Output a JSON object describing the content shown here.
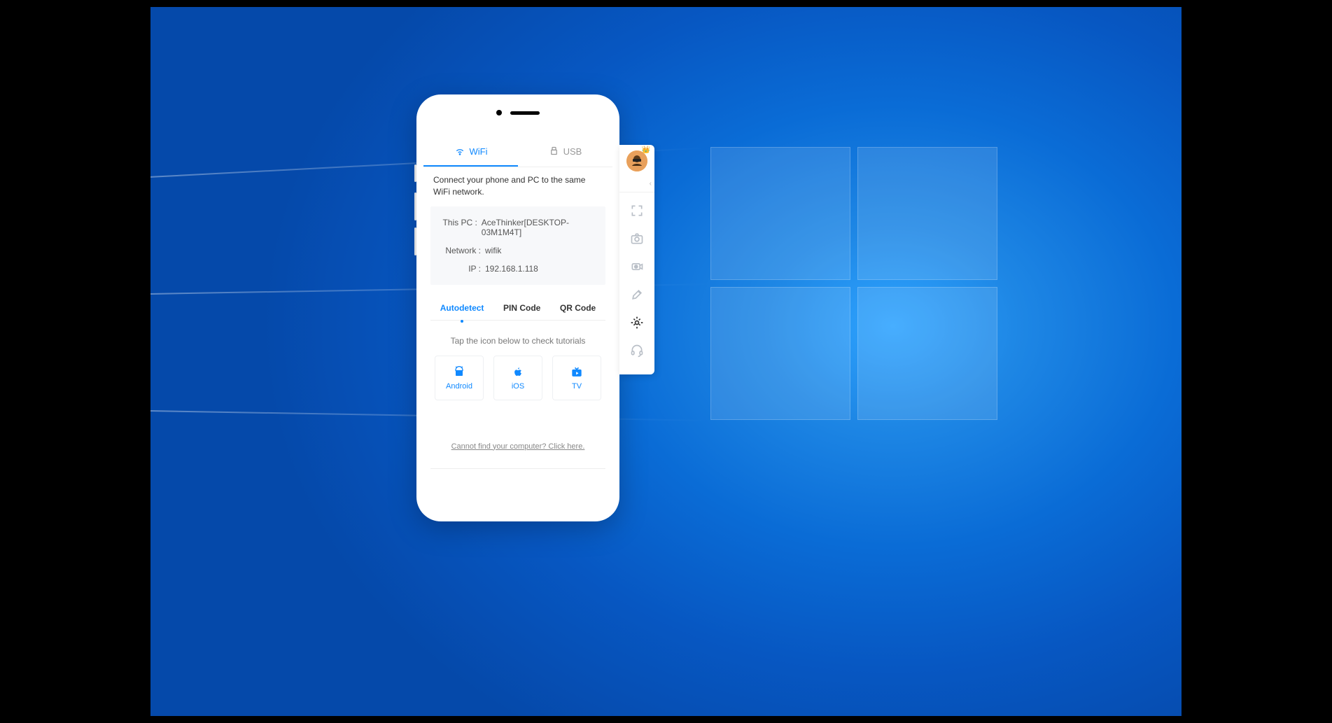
{
  "tabs": {
    "wifi": "WiFi",
    "usb": "USB"
  },
  "instruction": "Connect your phone and PC to the same WiFi network.",
  "info": {
    "pc_label": "This PC :",
    "pc_value": "AceThinker[DESKTOP-03M1M4T]",
    "network_label": "Network :",
    "network_value": "wifik",
    "ip_label": "IP :",
    "ip_value": "192.168.1.118"
  },
  "detect_tabs": {
    "auto": "Autodetect",
    "pin": "PIN Code",
    "qr": "QR Code"
  },
  "tutorial_hint": "Tap the icon below to check tutorials",
  "platforms": {
    "android": "Android",
    "ios": "iOS",
    "tv": "TV"
  },
  "help_link": "Cannot find your computer? Click here."
}
